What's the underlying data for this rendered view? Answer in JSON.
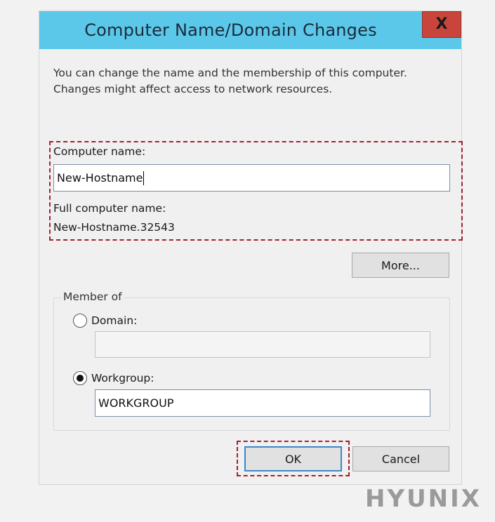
{
  "dialog": {
    "title": "Computer Name/Domain Changes",
    "close_label": "X",
    "intro": "You can change the name and the membership of this computer. Changes might affect access to network resources."
  },
  "computer_name": {
    "label": "Computer name:",
    "value": "New-Hostname"
  },
  "full_name": {
    "label": "Full computer name:",
    "value": "New-Hostname.32543"
  },
  "more_button": "More...",
  "member_of": {
    "legend": "Member of",
    "domain": {
      "label": "Domain:",
      "selected": false,
      "value": ""
    },
    "workgroup": {
      "label": "Workgroup:",
      "selected": true,
      "value": "WORKGROUP"
    }
  },
  "buttons": {
    "ok": "OK",
    "cancel": "Cancel"
  },
  "branding": "HYUNIX",
  "colors": {
    "titlebar": "#5bc8ea",
    "close": "#c9453c",
    "highlight": "#a51f35",
    "default_button_border": "#3d87c9"
  }
}
